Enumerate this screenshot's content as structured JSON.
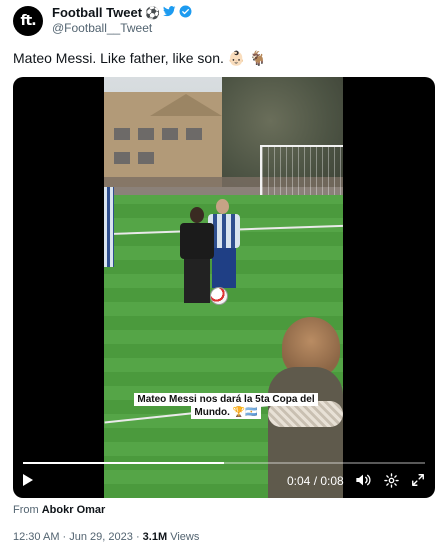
{
  "account": {
    "avatar_text": "ft.",
    "display_name": "Football Tweet",
    "name_emoji": "⚽",
    "handle": "@Football__Tweet",
    "verified_color": "#1d9bf0"
  },
  "tweet": {
    "text": "Mateo Messi. Like father, like son. 👶🏻 🐐"
  },
  "video": {
    "caption_line1": "Mateo Messi nos dará la 5ta Copa del",
    "caption_line2": "Mundo. 🏆🇦🇷",
    "time_display": "0:04 / 0:08",
    "progress_percent": 50,
    "icons": [
      "play-icon",
      "volume-icon",
      "settings-icon",
      "fullscreen-icon"
    ]
  },
  "source": {
    "prefix": "From",
    "name": "Abokr Omar"
  },
  "meta": {
    "time": "12:30 AM",
    "separator": " · ",
    "date": "Jun 29, 2023",
    "views_count": "3.1M",
    "views_label": "Views"
  }
}
